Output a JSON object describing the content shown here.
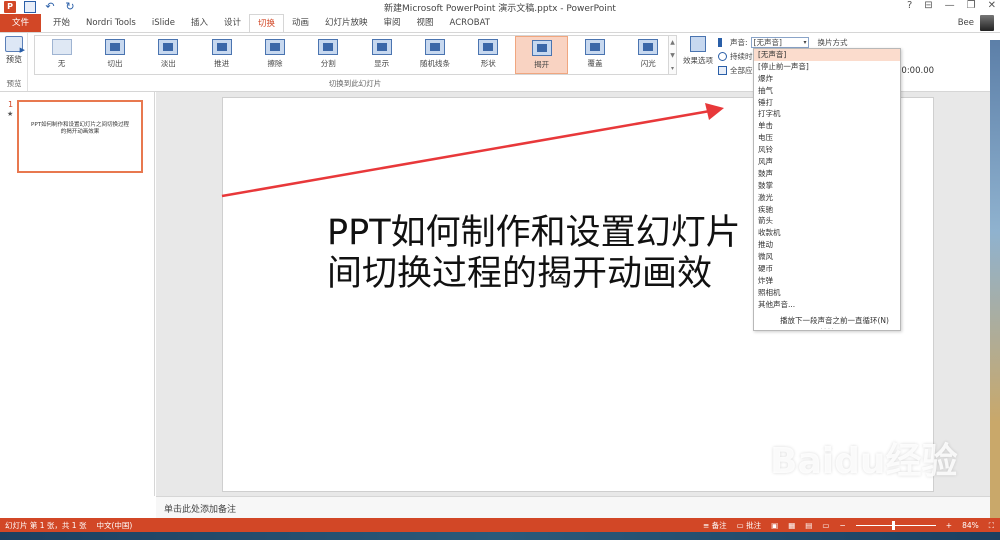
{
  "window": {
    "title": "新建Microsoft PowerPoint 演示文稿.pptx - PowerPoint",
    "controls": [
      "?",
      "⊟",
      "—",
      "❐",
      "✕"
    ]
  },
  "quick_access": {
    "app_logo": "P"
  },
  "tabs": [
    "文件",
    "开始",
    "Nordri Tools",
    "iSlide",
    "插入",
    "设计",
    "切换",
    "动画",
    "幻灯片放映",
    "审阅",
    "视图",
    "ACROBAT"
  ],
  "active_tab": "切换",
  "user": {
    "name": "Bee"
  },
  "ribbon": {
    "preview_label": "预览",
    "preview_group_label": "预览",
    "transitions_group_label": "切换到此幻灯片",
    "gallery": [
      "无",
      "切出",
      "淡出",
      "推进",
      "擦除",
      "分割",
      "显示",
      "随机线条",
      "形状",
      "揭开",
      "覆盖",
      "闪光"
    ],
    "selected_transition": "揭开",
    "effect_options": "效果选项",
    "sound_label": "声音:",
    "sound_value": "[无声音]",
    "switch_mode_label": "换片方式",
    "duration_label": "持续时",
    "apply_all_label": "全部应",
    "time_value": "00:00.00"
  },
  "sound_dropdown": {
    "items": [
      "[无声音]",
      "[停止前一声音]",
      "爆炸",
      "抽气",
      "锤打",
      "打字机",
      "单击",
      "电压",
      "风铃",
      "风声",
      "鼓声",
      "鼓掌",
      "激光",
      "疾驰",
      "箭头",
      "收款机",
      "推动",
      "微风",
      "硬币",
      "炸弹",
      "照相机",
      "其他声音..."
    ],
    "highlighted": "[无声音]",
    "loop_option": "播放下一段声音之前一直循环(N)"
  },
  "slide_panel": {
    "slide_number": "1",
    "thumb_text": "PPT如何制作和设置幻灯片之间切换过程的揭开动画效果"
  },
  "slide": {
    "title_line1": "PPT如何制作和设置幻灯片",
    "title_line2": "间切换过程的揭开动画效"
  },
  "notes_placeholder": "单击此处添加备注",
  "statusbar": {
    "slide_info": "幻灯片 第 1 张，共 1 张",
    "language": "中文(中国)",
    "notes": "备注",
    "comments": "批注",
    "zoom": "84%"
  },
  "watermark": {
    "logo": "Baidu经验",
    "url": "jingyan.baidu.com"
  },
  "colors": {
    "accent": "#d24726",
    "selected_bg": "#f9d3c2",
    "arrow": "#e8383a"
  }
}
